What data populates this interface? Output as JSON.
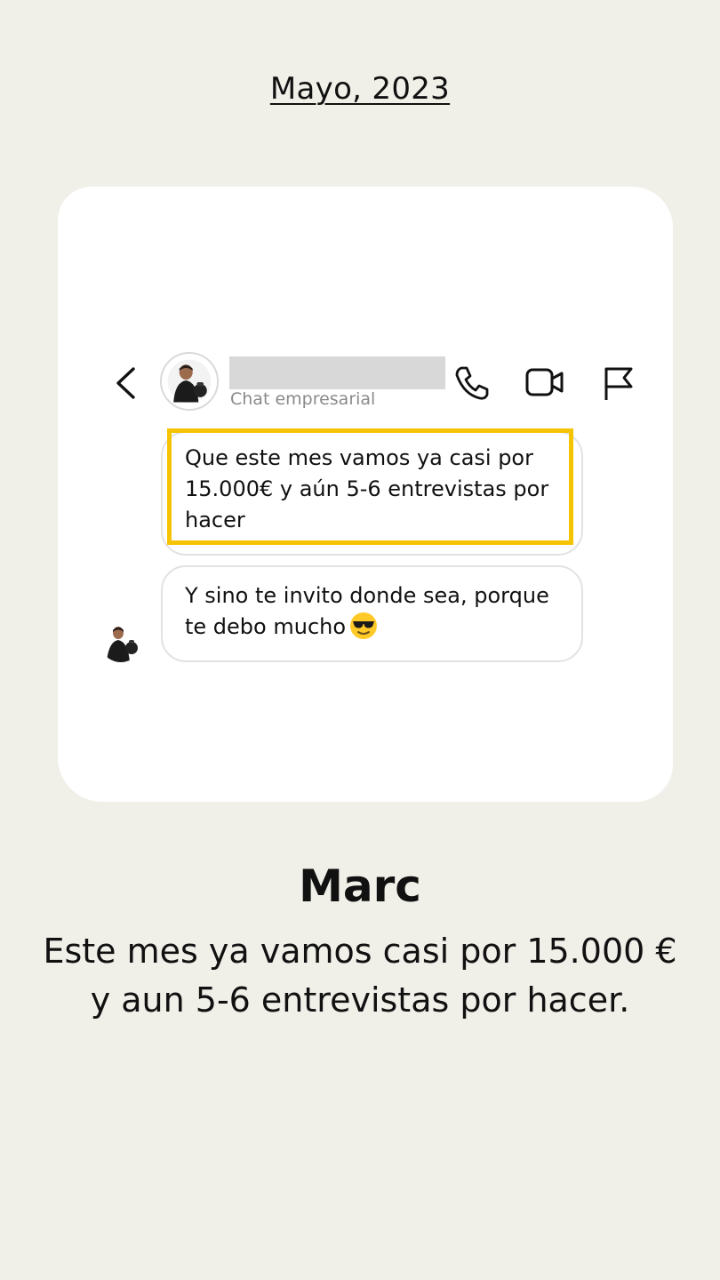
{
  "date_label": "Mayo, 2023",
  "chat": {
    "subtitle": "Chat empresarial",
    "icons": {
      "back": "chevron-left-icon",
      "call": "phone-icon",
      "video": "video-camera-icon",
      "report": "flag-icon"
    },
    "messages": [
      {
        "text": "Que este mes vamos ya casi por 15.000€ y aún 5-6 entrevistas por hacer",
        "highlighted": true
      },
      {
        "text": "Y sino te invito donde sea, porque te debo mucho",
        "emoji": "smiling-face-with-sunglasses"
      }
    ],
    "highlight_color": "#f5c400"
  },
  "testimonial": {
    "name": "Marc",
    "quote": "Este mes ya vamos casi por 15.000 € y aun 5-6 entrevistas por hacer."
  }
}
